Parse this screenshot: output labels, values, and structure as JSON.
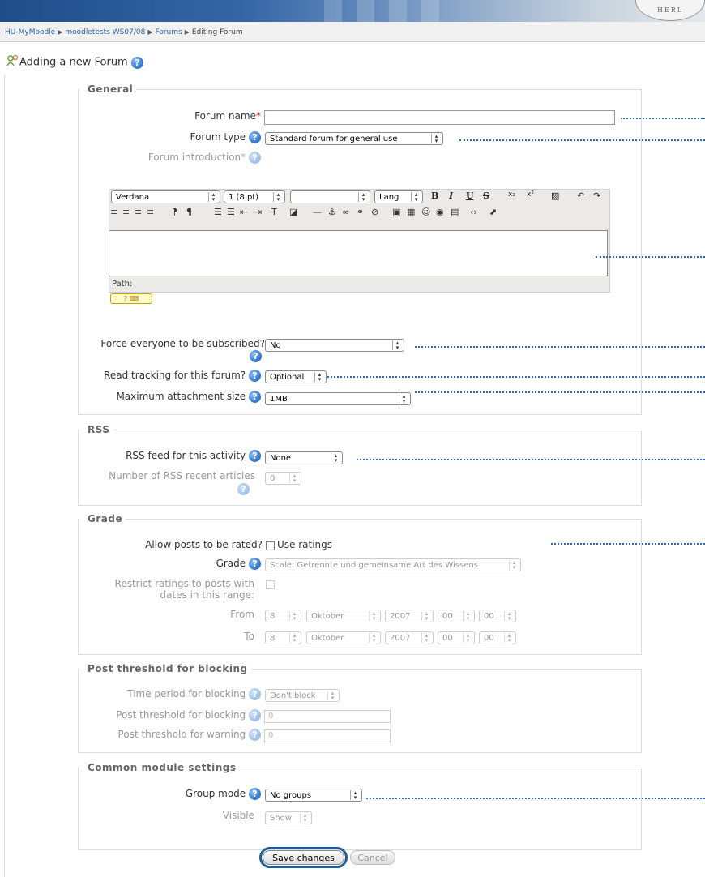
{
  "seal_text": "HERL",
  "breadcrumb": [
    {
      "label": "HU-MyMoodle",
      "link": true
    },
    {
      "label": "moodletests WS07/08",
      "link": true
    },
    {
      "label": "Forums",
      "link": true
    },
    {
      "label": "Editing Forum",
      "link": false
    }
  ],
  "breadcrumb_sep": "▶",
  "page_title": "Adding a new Forum",
  "help_glyph": "?",
  "required_mark": "*",
  "general": {
    "legend": "General",
    "forum_name_label": "Forum name",
    "forum_name_value": "",
    "forum_type_label": "Forum type",
    "forum_type_value": "Standard forum for general use",
    "forum_intro_label": "Forum introduction"
  },
  "editor": {
    "font_value": "Verdana",
    "size_value": "1 (8 pt)",
    "style_value": "",
    "lang_value": "Lang",
    "bold": "B",
    "italic": "I",
    "underline": "U",
    "strike": "S",
    "sub": "x₂",
    "sup": "x²",
    "row2_icons": [
      "≡",
      "≡",
      "≡",
      "≡",
      "⁋",
      "¶",
      "☰",
      "☰",
      "⇤",
      "⇥",
      "T",
      "◪",
      "—",
      "⚓",
      "∞",
      "⚭",
      "⊘",
      "▣",
      "▦",
      "☺",
      "◉",
      "▤",
      "‹›",
      "⬈"
    ],
    "path_label": "Path:",
    "kbd_label": "? ⌨"
  },
  "subscribe": {
    "label": "Force everyone to be subscribed?",
    "value": "No"
  },
  "read_tracking": {
    "label": "Read tracking for this forum?",
    "value": "Optional"
  },
  "max_attach": {
    "label": "Maximum attachment size",
    "value": "1MB"
  },
  "rss": {
    "legend": "RSS",
    "feed_label": "RSS feed for this activity",
    "feed_value": "None",
    "articles_label": "Number of RSS recent articles",
    "articles_value": "0"
  },
  "grade": {
    "legend": "Grade",
    "allow_label": "Allow posts to be rated?",
    "use_ratings_label": "Use ratings",
    "grade_label": "Grade",
    "grade_value": "Scale: Getrennte und gemeinsame Art des Wissens",
    "restrict_label_1": "Restrict ratings to posts with",
    "restrict_label_2": "dates in this range:",
    "from_label": "From",
    "to_label": "To",
    "from": {
      "day": "8",
      "month": "Oktober",
      "year": "2007",
      "hour": "00",
      "minute": "00"
    },
    "to": {
      "day": "8",
      "month": "Oktober",
      "year": "2007",
      "hour": "00",
      "minute": "00"
    }
  },
  "blocking": {
    "legend": "Post threshold for blocking",
    "period_label": "Time period for blocking",
    "period_value": "Don't block",
    "threshold_label": "Post threshold for blocking",
    "threshold_value": "0",
    "warning_label": "Post threshold for warning",
    "warning_value": "0"
  },
  "common": {
    "legend": "Common module settings",
    "group_label": "Group mode",
    "group_value": "No groups",
    "visible_label": "Visible",
    "visible_value": "Show"
  },
  "buttons": {
    "save": "Save changes",
    "cancel": "Cancel"
  }
}
